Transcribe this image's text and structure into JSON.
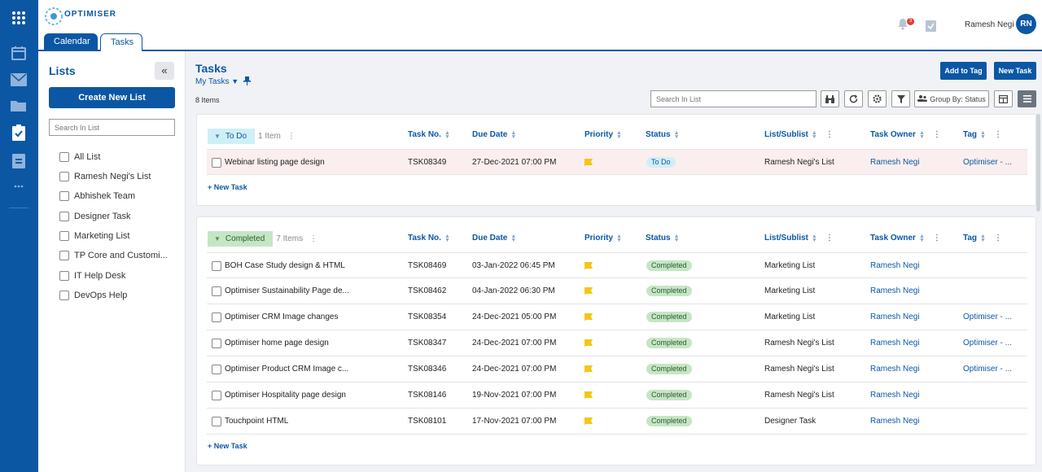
{
  "app": {
    "logo": "OPTIMISER",
    "user": "Ramesh Negi",
    "initials": "RN",
    "notifications": "3"
  },
  "tabs": [
    {
      "label": "Calendar"
    },
    {
      "label": "Tasks"
    }
  ],
  "sidebar": {
    "title": "Lists",
    "create_label": "Create New List",
    "search_placeholder": "Search In List",
    "items": [
      {
        "label": "All List"
      },
      {
        "label": "Ramesh Negi's List"
      },
      {
        "label": "Abhishek Team"
      },
      {
        "label": "Designer Task"
      },
      {
        "label": "Marketing List"
      },
      {
        "label": "TP Core and Customi..."
      },
      {
        "label": "IT Help Desk"
      },
      {
        "label": "DevOps Help"
      }
    ]
  },
  "main": {
    "title": "Tasks",
    "view": "My Tasks",
    "count": "8 Items",
    "add_to_tag": "Add to Tag",
    "new_task": "New Task",
    "search_placeholder": "Search In List",
    "group_by": "Group By: Status"
  },
  "columns": [
    "Task No.",
    "Due Date",
    "Priority",
    "Status",
    "List/Sublist",
    "Task Owner",
    "Tag"
  ],
  "groups": {
    "todo": {
      "name": "To Do",
      "count": "1 Item",
      "new_task": "+ New Task",
      "rows": [
        {
          "name": "Webinar listing page design",
          "no": "TSK08349",
          "due": "27-Dec-2021 07:00 PM",
          "status": "To Do",
          "list": "Ramesh Negi's List",
          "owner": "Ramesh Negi",
          "tag": "Optimiser - ..."
        }
      ]
    },
    "completed": {
      "name": "Completed",
      "count": "7 Items",
      "new_task": "+ New Task",
      "rows": [
        {
          "name": "BOH Case Study design & HTML",
          "no": "TSK08469",
          "due": "03-Jan-2022 06:45 PM",
          "status": "Completed",
          "list": "Marketing List",
          "owner": "Ramesh Negi",
          "tag": ""
        },
        {
          "name": "Optimiser Sustainability Page de...",
          "no": "TSK08462",
          "due": "04-Jan-2022 06:30 PM",
          "status": "Completed",
          "list": "Marketing List",
          "owner": "Ramesh Negi",
          "tag": ""
        },
        {
          "name": "Optimiser CRM Image changes",
          "no": "TSK08354",
          "due": "24-Dec-2021 05:00 PM",
          "status": "Completed",
          "list": "Marketing List",
          "owner": "Ramesh Negi",
          "tag": "Optimiser - ..."
        },
        {
          "name": "Optimiser home page design",
          "no": "TSK08347",
          "due": "24-Dec-2021 07:00 PM",
          "status": "Completed",
          "list": "Ramesh Negi's List",
          "owner": "Ramesh Negi",
          "tag": "Optimiser - ..."
        },
        {
          "name": "Optimiser Product CRM Image c...",
          "no": "TSK08346",
          "due": "24-Dec-2021 07:00 PM",
          "status": "Completed",
          "list": "Ramesh Negi's List",
          "owner": "Ramesh Negi",
          "tag": "Optimiser - ..."
        },
        {
          "name": "Optimiser Hospitality page design",
          "no": "TSK08146",
          "due": "19-Nov-2021 07:00 PM",
          "status": "Completed",
          "list": "Ramesh Negi's List",
          "owner": "Ramesh Negi",
          "tag": ""
        },
        {
          "name": "Touchpoint HTML",
          "no": "TSK08101",
          "due": "17-Nov-2021 07:00 PM",
          "status": "Completed",
          "list": "Designer Task",
          "owner": "Ramesh Negi",
          "tag": ""
        }
      ]
    }
  },
  "colors": {
    "brand": "#0b57a4",
    "flag": "#f5c518",
    "todo_bg": "#cfeff7",
    "completed_bg": "#c5e6c4"
  }
}
